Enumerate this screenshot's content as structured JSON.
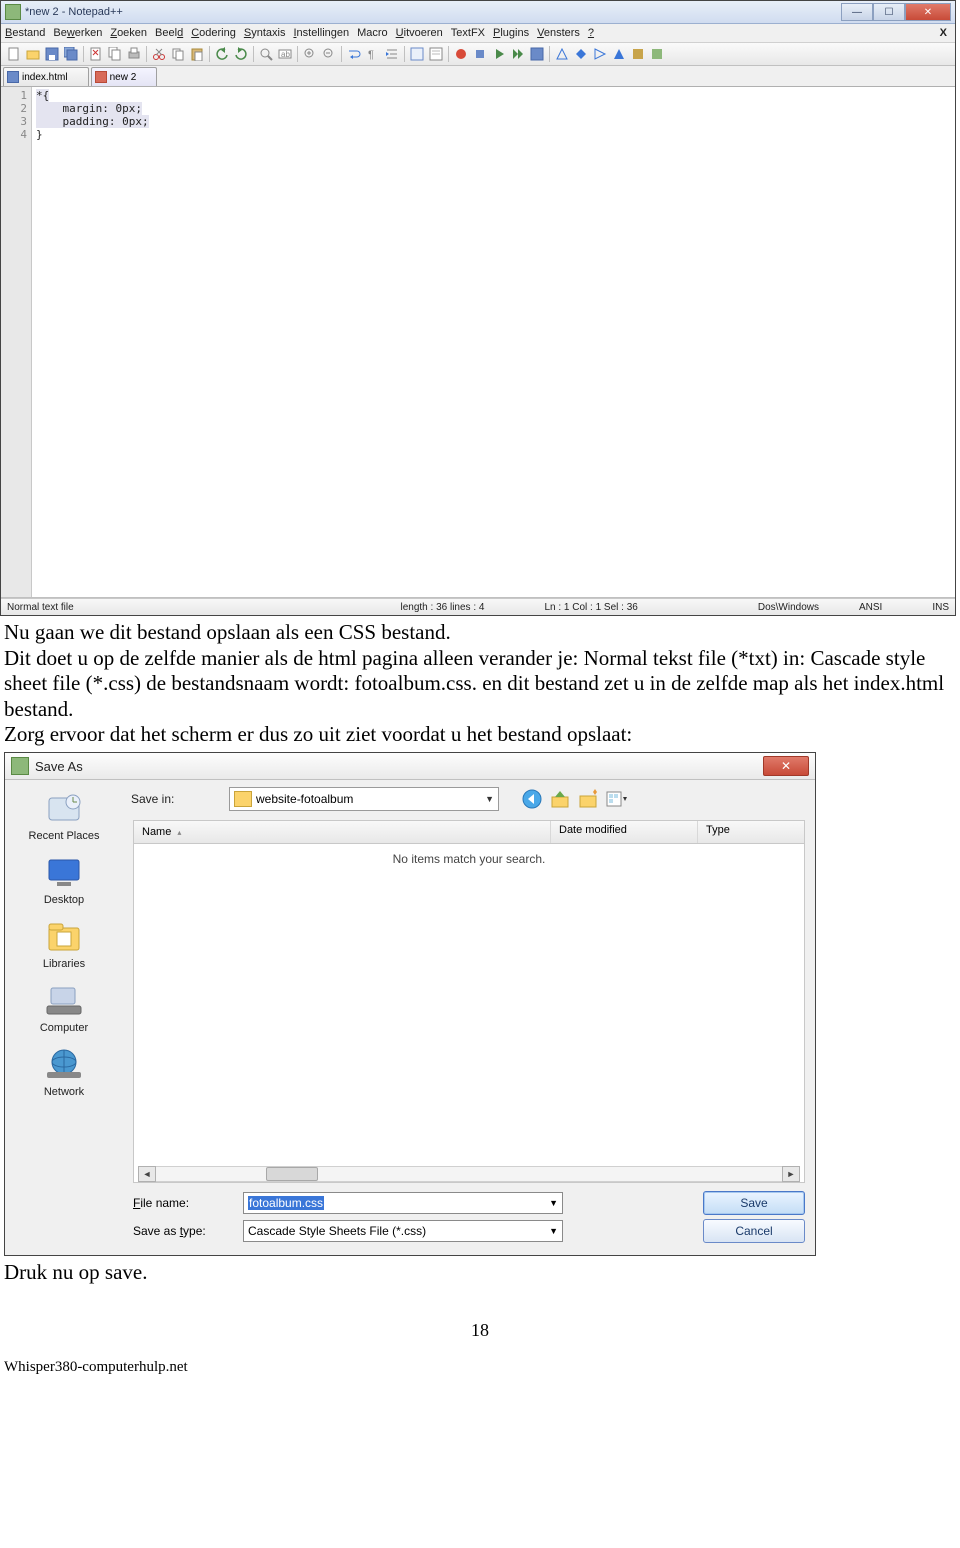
{
  "npp": {
    "title": "*new 2 - Notepad++",
    "menus": [
      "Bestand",
      "Bewerken",
      "Zoeken",
      "Beeld",
      "Codering",
      "Syntaxis",
      "Instellingen",
      "Macro",
      "Uitvoeren",
      "TextFX",
      "Plugins",
      "Vensters",
      "?"
    ],
    "tabs": [
      {
        "label": "index.html",
        "active": false,
        "icon": "blue"
      },
      {
        "label": "new 2",
        "active": true,
        "icon": "red"
      }
    ],
    "gutter": [
      "1",
      "2",
      "3",
      "4"
    ],
    "code": {
      "l1": "*{",
      "l2": "    margin: 0px;",
      "l3": "    padding: 0px;",
      "l4": "}"
    },
    "status": {
      "left": "Normal text file",
      "mid1": "length : 36    lines : 4",
      "mid2": "Ln : 1    Col : 1    Sel : 36",
      "enc": "Dos\\Windows",
      "cs": "ANSI",
      "mode": "INS"
    }
  },
  "bodytext": {
    "p1": "Nu gaan we dit bestand opslaan als een CSS bestand.",
    "p2": "Dit doet u op de zelfde manier als de html pagina alleen verander je: Normal tekst file (*txt) in: Cascade style sheet file (*.css) de bestandsnaam wordt: fotoalbum.css. en dit bestand zet u in de zelfde map als het index.html bestand.",
    "p3": "Zorg ervoor dat het scherm er dus zo uit ziet voordat u het bestand opslaat:",
    "p4": "Druk nu op save."
  },
  "save": {
    "title": "Save As",
    "save_in_label": "Save in:",
    "save_in_value": "website-fotoalbum",
    "cols": {
      "name": "Name",
      "date": "Date modified",
      "type": "Type"
    },
    "empty": "No items match your search.",
    "places": [
      "Recent Places",
      "Desktop",
      "Libraries",
      "Computer",
      "Network"
    ],
    "filename_label": "File name:",
    "filename_value": "fotoalbum.css",
    "type_label": "Save as type:",
    "type_value": "Cascade Style Sheets File (*.css)",
    "save_btn": "Save",
    "cancel_btn": "Cancel"
  },
  "pagenum": "18",
  "footer": "Whisper380-computerhulp.net"
}
